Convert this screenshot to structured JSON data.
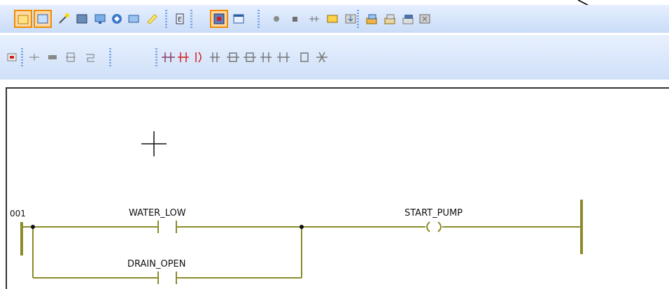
{
  "ladder": {
    "rung_number": "001",
    "contact1": "WATER_LOW",
    "contact2": "DRAIN_OPEN",
    "coil": "START_PUMP"
  },
  "icons": {
    "row1": [
      "folder-icon",
      "window-icon",
      "wand-icon",
      "screen-icon",
      "monitor-icon",
      "diamond-icon",
      "panel-icon",
      "note-icon",
      "edit-e-icon",
      "device-icon",
      "help-form-icon",
      "circle-icon",
      "square-icon",
      "branch-icon",
      "image-icon",
      "download-icon",
      "stack-icon",
      "stack2-icon",
      "stack3-icon",
      "close-box-icon"
    ],
    "row2": [
      "alert-icon",
      "rung-insert-icon",
      "rung-delete-icon",
      "block-icon",
      "step-icon",
      "contact-icons"
    ]
  },
  "colors": {
    "wire": "#8b8b2a",
    "highlight": "#f08a00"
  }
}
